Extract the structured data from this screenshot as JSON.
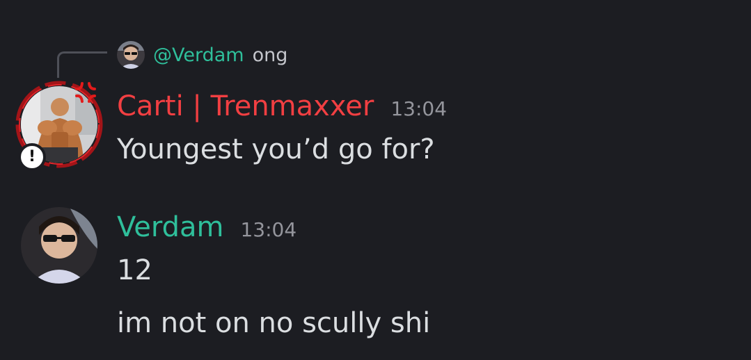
{
  "reply": {
    "author": "@Verdam",
    "text": "ong",
    "avatar_icon": "user-avatar-verdam"
  },
  "messages": [
    {
      "author": "Carti | Trenmaxxer",
      "timestamp": "13:04",
      "lines": [
        "Youngest you’d go for?"
      ],
      "author_color": "#f23f42",
      "avatar_icon": "user-avatar-carti",
      "decoration_icon": "anger-symbol-icon",
      "badge_icon": "exclamation-badge-icon",
      "badge_text": "!"
    },
    {
      "author": "Verdam",
      "timestamp": "13:04",
      "lines": [
        "12",
        "im not on no scully shi"
      ],
      "author_color": "#2fbf9b",
      "avatar_icon": "user-avatar-verdam"
    }
  ],
  "theme": {
    "background": "#1c1d22",
    "text": "#dbdee1",
    "muted": "#94959c",
    "reply_line": "#4e5058"
  }
}
